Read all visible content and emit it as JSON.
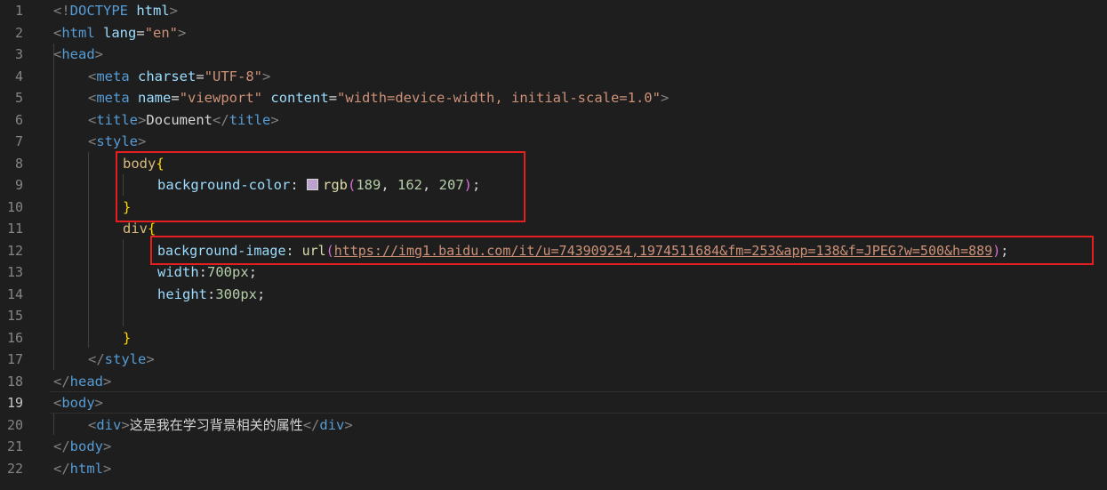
{
  "editor": {
    "active_line": "19",
    "line_numbers": [
      "1",
      "2",
      "3",
      "4",
      "5",
      "6",
      "7",
      "8",
      "9",
      "10",
      "11",
      "12",
      "13",
      "14",
      "15",
      "16",
      "17",
      "18",
      "19",
      "20",
      "21",
      "22"
    ],
    "colors": {
      "background": "#1e1e1e",
      "highlight_box": "#e51f1f",
      "swatch": "#bda2cf"
    },
    "lines": {
      "l1": {
        "open": "<!",
        "kw": "DOCTYPE",
        "sp": " ",
        "name": "html",
        "close": ">"
      },
      "l2": {
        "open": "<",
        "tag": "html",
        "sp": " ",
        "attr": "lang",
        "eq": "=",
        "val": "\"en\"",
        "close": ">"
      },
      "l3": {
        "open": "<",
        "tag": "head",
        "close": ">"
      },
      "l4": {
        "open": "<",
        "tag": "meta",
        "sp": " ",
        "attr": "charset",
        "eq": "=",
        "val": "\"UTF-8\"",
        "close": ">"
      },
      "l5": {
        "open": "<",
        "tag": "meta",
        "sp": " ",
        "attr1": "name",
        "eq1": "=",
        "val1": "\"viewport\"",
        "sp2": " ",
        "attr2": "content",
        "eq2": "=",
        "val2": "\"width=device-width, initial-scale=1.0\"",
        "close": ">"
      },
      "l6": {
        "open": "<",
        "tag": "title",
        "close": ">",
        "text": "Document",
        "open2": "</",
        "tag2": "title",
        "close2": ">"
      },
      "l7": {
        "open": "<",
        "tag": "style",
        "close": ">"
      },
      "l8": {
        "selector": "body",
        "brace": "{"
      },
      "l9": {
        "prop": "background-color",
        "colon": ": ",
        "fn": "rgb",
        "paren_open": "(",
        "n1": "189",
        "c1": ", ",
        "n2": "162",
        "c2": ", ",
        "n3": "207",
        "paren_close": ")",
        "semi": ";"
      },
      "l10": {
        "brace": "}"
      },
      "l11": {
        "selector": "div",
        "brace": "{"
      },
      "l12": {
        "prop": "background-image",
        "colon": ": ",
        "fn": "url",
        "paren_open": "(",
        "url": "https://img1.baidu.com/it/u=743909254,1974511684&fm=253&app=138&f=JPEG?w=500&h=889",
        "paren_close": ")",
        "semi": ";"
      },
      "l13": {
        "prop": "width",
        "colon": ":",
        "num": "700px",
        "semi": ";"
      },
      "l14": {
        "prop": "height",
        "colon": ":",
        "num": "300px",
        "semi": ";"
      },
      "l16": {
        "brace": "}"
      },
      "l17": {
        "open": "</",
        "tag": "style",
        "close": ">"
      },
      "l18": {
        "open": "</",
        "tag": "head",
        "close": ">"
      },
      "l19": {
        "open": "<",
        "tag": "body",
        "close": ">"
      },
      "l20": {
        "open": "<",
        "tag": "div",
        "close": ">",
        "text": "这是我在学习背景相关的属性",
        "open2": "</",
        "tag2": "div",
        "close2": ">"
      },
      "l21": {
        "open": "</",
        "tag": "body",
        "close": ">"
      },
      "l22": {
        "open": "</",
        "tag": "html",
        "close": ">"
      }
    }
  }
}
